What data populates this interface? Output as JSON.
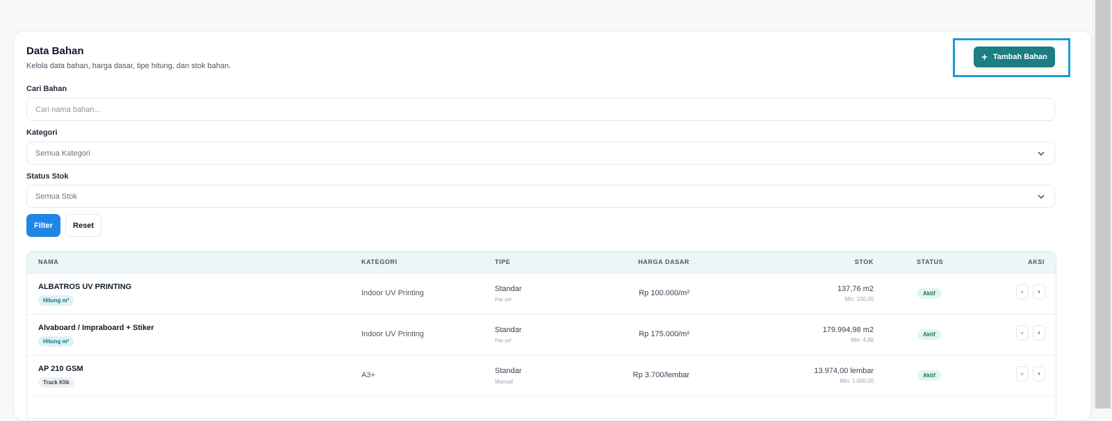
{
  "header": {
    "title": "Data Bahan",
    "subtitle": "Kelola data bahan, harga dasar, tipe hitung, dan stok bahan.",
    "add_button_label": "Tambah Bahan",
    "add_button_icon": "plus-icon"
  },
  "filters": {
    "search_label": "Cari Bahan",
    "search_placeholder": "Cari nama bahan...",
    "category_label": "Kategori",
    "category_value": "Semua Kategori",
    "stock_status_label": "Status Stok",
    "stock_status_value": "Semua Stok",
    "filter_button": "Filter",
    "reset_button": "Reset"
  },
  "table": {
    "columns": [
      "NAMA",
      "KATEGORI",
      "TIPE",
      "HARGA DASAR",
      "STOK",
      "STATUS",
      "AKSI"
    ],
    "rows": [
      {
        "name": "ALBATROS UV PRINTING",
        "tag": "Hitung m²",
        "category": "Indoor UV Printing",
        "type": "Standar",
        "type_sub": "Per m²",
        "price": "Rp 100.000/m²",
        "stock": "137,76 m2",
        "stock_min": "Min: 100,00",
        "status": "Aktif"
      },
      {
        "name": "Alvaboard / Impraboard + Stiker",
        "tag": "Hitung m²",
        "category": "Indoor UV Printing",
        "type": "Standar",
        "type_sub": "Per m²",
        "price": "Rp 175.000/m²",
        "stock": "179.994,98 m2",
        "stock_min": "Min: 4,88",
        "status": "Aktif"
      },
      {
        "name": "AP 210 GSM",
        "tag": "Track Klik",
        "category": "A3+",
        "type": "Standar",
        "type_sub": "Manual",
        "price": "Rp 3.700/lembar",
        "stock": "13.974,00 lembar",
        "stock_min": "Min: 1.000,00",
        "status": "Aktif"
      }
    ]
  },
  "colors": {
    "primary_teal": "#1c7d83",
    "filter_blue": "#1f86e6",
    "highlight_blue": "#1a9bd7",
    "table_header_bg": "#eaf6f8"
  }
}
